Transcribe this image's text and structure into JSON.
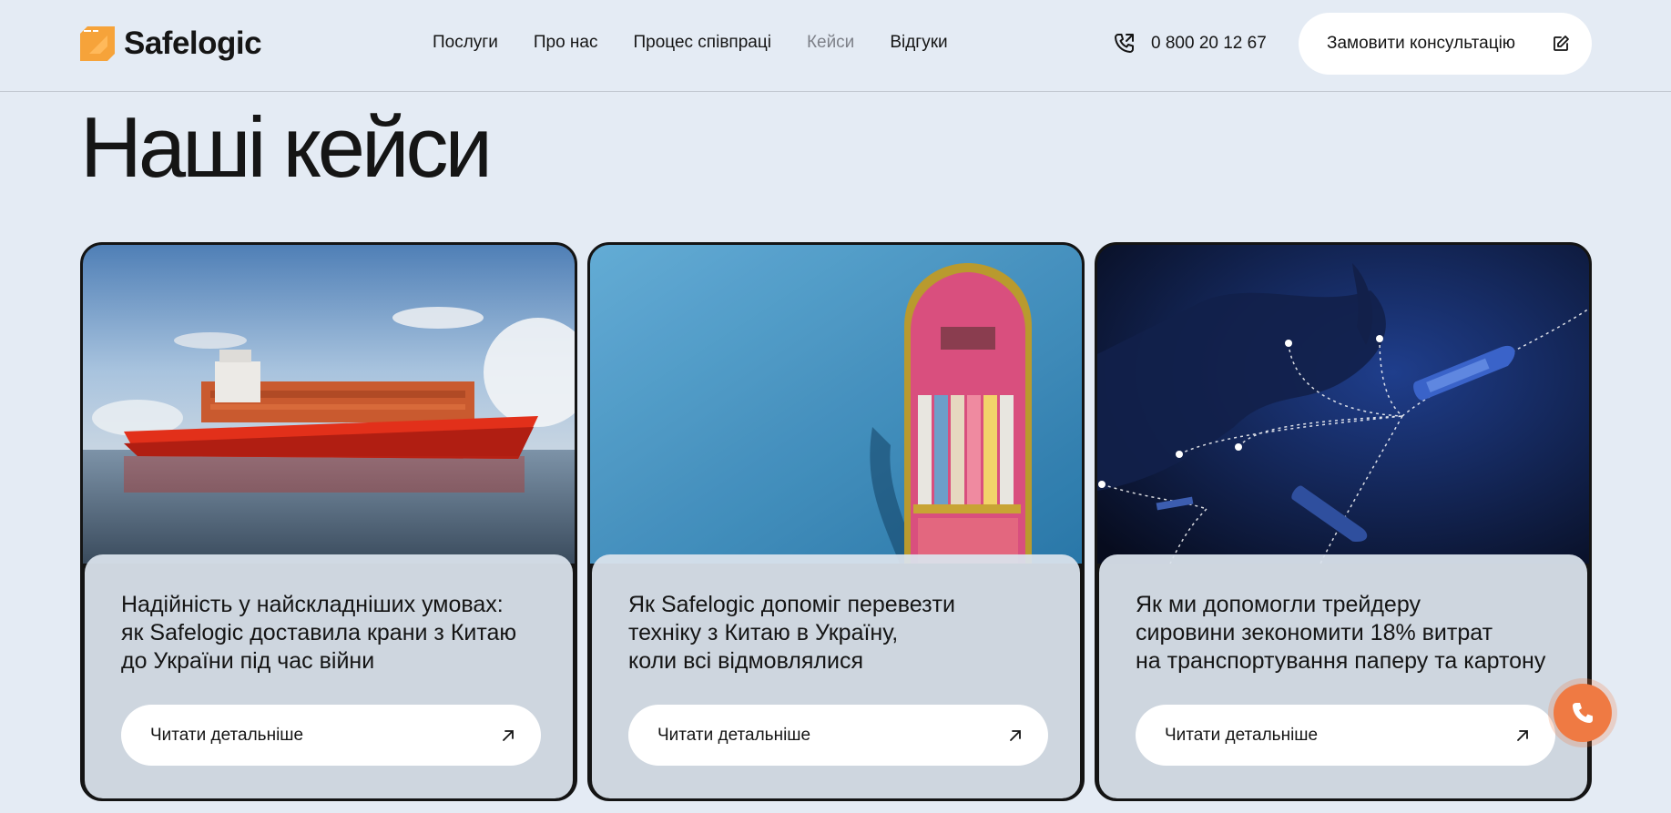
{
  "brand": {
    "name": "Safelogic",
    "accent": "#f6a33a"
  },
  "nav": {
    "items": [
      {
        "label": "Послуги",
        "active": false
      },
      {
        "label": "Про нас",
        "active": false
      },
      {
        "label": "Процес співпраці",
        "active": false
      },
      {
        "label": "Кейси",
        "active": true
      },
      {
        "label": "Відгуки",
        "active": false
      }
    ]
  },
  "contact": {
    "phone": "0 800 20 12 67",
    "phone_icon": "phone-icon"
  },
  "cta": {
    "label": "Замовити консультацію",
    "icon": "edit-icon"
  },
  "page": {
    "title": "Наші кейси"
  },
  "cases": [
    {
      "image": "red-cargo-ship-at-sea",
      "text": "Надійність у найскладніших умовах:\nяк Safelogic доставила крани з Китаю\nдо України під час війни",
      "button": "Читати детальніше",
      "button_icon": "arrow-up-right-icon"
    },
    {
      "image": "aerial-container-ship",
      "text": "Як Safelogic допоміг перевезти\nтехніку з Китаю в Україну,\nколи всі відмовлялися",
      "button": "Читати детальніше",
      "button_icon": "arrow-up-right-icon"
    },
    {
      "image": "shipping-routes-map",
      "text": "Як ми допомогли трейдеру\nсировини зекономити 18% витрат\nна транспортування паперу та картону",
      "button": "Читати детальніше",
      "button_icon": "arrow-up-right-icon"
    }
  ],
  "fab": {
    "icon": "phone-icon",
    "color": "#ef7a43"
  }
}
